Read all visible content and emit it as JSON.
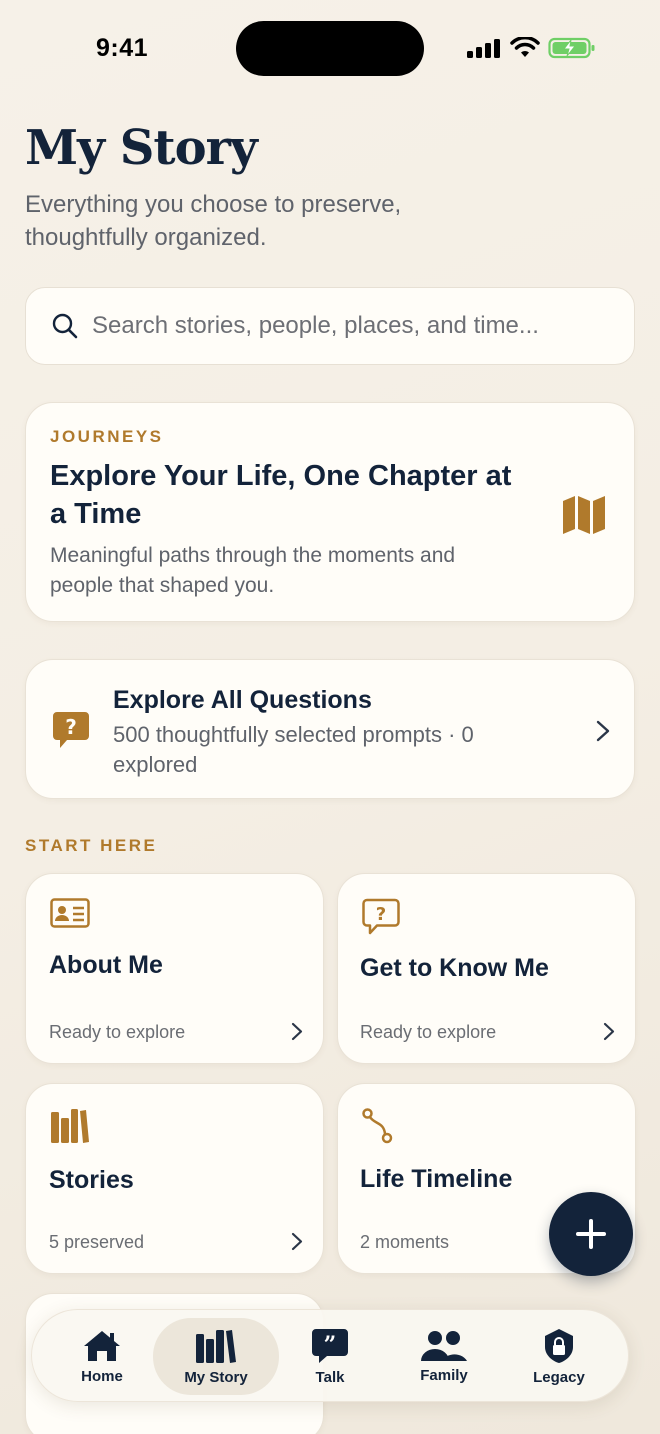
{
  "status_bar": {
    "time": "9:41"
  },
  "header": {
    "title": "My Story",
    "subtitle": "Everything you choose to preserve, thoughtfully organized."
  },
  "search": {
    "placeholder": "Search stories, people, places, and time..."
  },
  "journeys": {
    "kicker": "JOURNEYS",
    "title": "Explore Your Life, One Chapter at a Time",
    "description": "Meaningful paths through the moments and people that shaped you.",
    "icon": "map-icon"
  },
  "questions": {
    "title": "Explore All Questions",
    "description": "500 thoughtfully selected prompts · 0 explored",
    "icon": "question-bubble-icon"
  },
  "start_here": {
    "label": "START HERE",
    "tiles": [
      {
        "title": "About Me",
        "status": "Ready to explore",
        "icon": "id-card-icon"
      },
      {
        "title": "Get to Know Me",
        "status": "Ready to explore",
        "icon": "question-chat-icon"
      },
      {
        "title": "Stories",
        "status": "5 preserved",
        "icon": "books-icon"
      },
      {
        "title": "Life Timeline",
        "status": "2 moments",
        "icon": "route-icon"
      }
    ]
  },
  "tabs": [
    {
      "label": "Home",
      "icon": "house-icon",
      "active": false
    },
    {
      "label": "My Story",
      "icon": "books-icon",
      "active": true
    },
    {
      "label": "Talk",
      "icon": "quote-bubble-icon",
      "active": false
    },
    {
      "label": "Family",
      "icon": "people-icon",
      "active": false
    },
    {
      "label": "Legacy",
      "icon": "shield-lock-icon",
      "active": false
    }
  ],
  "colors": {
    "accent": "#b07a2c",
    "navy": "#13233a",
    "background": "#f5f0e7",
    "card": "#fffdf8"
  }
}
